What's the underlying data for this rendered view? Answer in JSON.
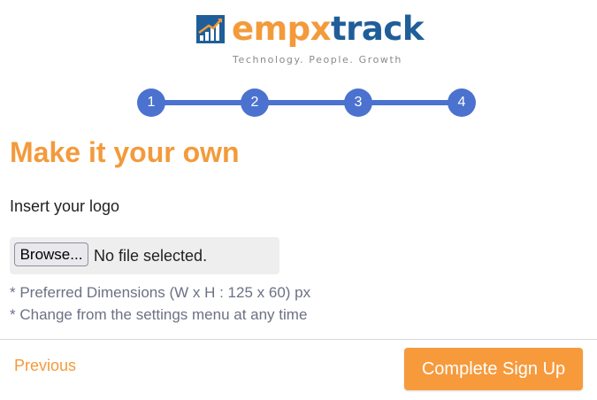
{
  "brand": {
    "name_part1": "empx",
    "name_part2": "track",
    "tagline": "Technology. People. Growth",
    "colors": {
      "orange": "#f39a3b",
      "blue": "#1f5e99"
    }
  },
  "stepper": {
    "steps": [
      "1",
      "2",
      "3",
      "4"
    ],
    "color": "#4b72cf"
  },
  "page": {
    "title": "Make it your own",
    "subtitle": "Insert your logo"
  },
  "file_input": {
    "button_label": "Browse...",
    "status": "No file selected."
  },
  "notes": [
    "* Preferred Dimensions (W x H : 125 x 60) px",
    "* Change from the settings menu at any time"
  ],
  "footer": {
    "previous_label": "Previous",
    "complete_label": "Complete Sign Up"
  }
}
